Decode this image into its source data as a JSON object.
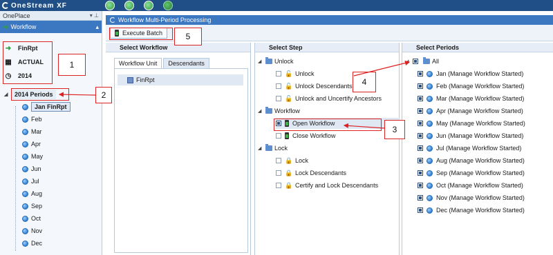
{
  "app": {
    "logo_text": "OneStream XF"
  },
  "top_icons": [
    {
      "name": "back-icon",
      "color": "#3fb24a"
    },
    {
      "name": "network-icon",
      "color": "#3fb24a"
    },
    {
      "name": "gear-icon",
      "color": "#3fb24a"
    },
    {
      "name": "circle-icon",
      "color": "#3fb24a"
    }
  ],
  "left": {
    "oneplace_label": "OnePlace",
    "pin_glyphs": "▾ ⊥",
    "workflow_label": "Workflow",
    "pov": {
      "workflow": "FinRpt",
      "scenario": "ACTUAL",
      "time": "2014"
    },
    "tree": {
      "root": "2014 Periods",
      "months": [
        "Jan FinRpt",
        "Feb",
        "Mar",
        "Apr",
        "May",
        "Jun",
        "Jul",
        "Aug",
        "Sep",
        "Oct",
        "Nov",
        "Dec"
      ]
    }
  },
  "main": {
    "title": "Workflow Multi-Period Processing",
    "execute_label": "Execute Batch",
    "select_workflow": {
      "header": "Select Workflow",
      "tabs": [
        "Workflow Unit",
        "Descendants"
      ],
      "unit": "FinRpt"
    },
    "select_step": {
      "header": "Select Step",
      "groups": [
        {
          "label": "Unlock",
          "steps": [
            "Unlock",
            "Unlock Descendants",
            "Unlock and Uncertify Ancestors"
          ]
        },
        {
          "label": "Workflow",
          "steps": [
            "Open Workflow",
            "Close Workflow"
          ]
        },
        {
          "label": "Lock",
          "steps": [
            "Lock",
            "Lock Descendants",
            "Certify and Lock Descendants"
          ]
        }
      ]
    },
    "select_periods": {
      "header": "Select Periods",
      "all_label": "All",
      "periods": [
        "Jan (Manage Workflow Started)",
        "Feb (Manage Workflow Started)",
        "Mar (Manage Workflow Started)",
        "Apr (Manage Workflow Started)",
        "May (Manage Workflow Started)",
        "Jun (Manage Workflow Started)",
        "Jul (Manage Workflow Started)",
        "Aug (Manage Workflow Started)",
        "Sep (Manage Workflow Started)",
        "Oct (Manage Workflow Started)",
        "Nov (Manage Workflow Started)",
        "Dec (Manage Workflow Started)"
      ]
    }
  },
  "callouts": [
    "1",
    "2",
    "3",
    "4",
    "5"
  ],
  "colors": {
    "header_blue": "#1f4f86",
    "panel_blue": "#3c77c2",
    "annotation_red": "#dd2222"
  }
}
